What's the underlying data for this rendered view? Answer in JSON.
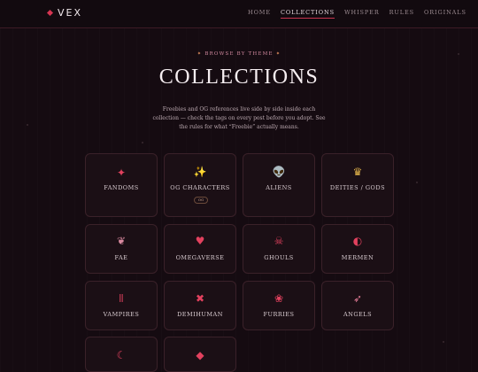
{
  "brand": {
    "name": "VEX"
  },
  "nav": {
    "links": [
      "HOME",
      "COLLECTIONS",
      "WHISPER",
      "RULES",
      "ORIGINALS"
    ],
    "active": "COLLECTIONS"
  },
  "hero": {
    "eyebrow": "BROWSE BY THEME",
    "title": "COLLECTIONS",
    "intro": "Freebies and OG references live side by side inside each collection — check the tags on every post before you adopt. See the rules for what “Freebie” actually means."
  },
  "collections": [
    {
      "label": "FANDOMS",
      "icon": "sparkle-icon"
    },
    {
      "label": "OG CHARACTERS",
      "icon": "twinkle-stars-icon",
      "badge": "OG"
    },
    {
      "label": "ALIENS",
      "icon": "alien-icon"
    },
    {
      "label": "DEITIES / GODS",
      "icon": "crown-icon"
    },
    {
      "label": "FAE",
      "icon": "leaf-icon"
    },
    {
      "label": "OMEGAVERSE",
      "icon": "heart-icon"
    },
    {
      "label": "GHOULS",
      "icon": "skull-icon"
    },
    {
      "label": "MERMEN",
      "icon": "half-circle-icon"
    },
    {
      "label": "VAMPIRES",
      "icon": "fangs-icon"
    },
    {
      "label": "DEMIHUMAN",
      "icon": "cross-bandage-icon"
    },
    {
      "label": "FURRIES",
      "icon": "paw-icon"
    },
    {
      "label": "ANGELS",
      "icon": "feather-icon"
    },
    {
      "label": "",
      "icon": "moon-icon"
    },
    {
      "label": "",
      "icon": "diamond-icon"
    }
  ],
  "colors": {
    "accent": "#e2415e",
    "gold": "#e0b24a",
    "background": "#150b11"
  }
}
